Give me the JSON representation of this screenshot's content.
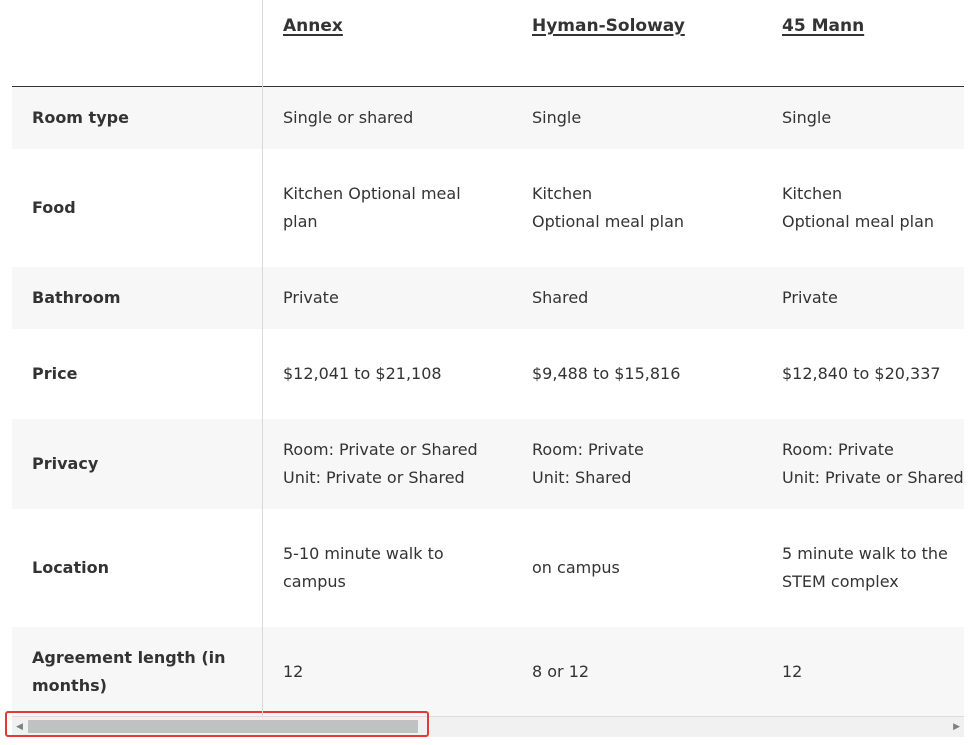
{
  "columns": [
    "Annex",
    "Hyman-Soloway",
    "45 Mann"
  ],
  "rows": [
    {
      "label": "Room type",
      "cells": [
        [
          "Single or shared"
        ],
        [
          "Single"
        ],
        [
          "Single"
        ]
      ]
    },
    {
      "label": "Food",
      "cells": [
        [
          "Kitchen Optional meal",
          "plan"
        ],
        [
          "Kitchen",
          "Optional meal plan"
        ],
        [
          "Kitchen",
          "Optional meal plan"
        ]
      ]
    },
    {
      "label": "Bathroom",
      "cells": [
        [
          "Private"
        ],
        [
          "Shared"
        ],
        [
          "Private"
        ]
      ]
    },
    {
      "label": "Price",
      "cells": [
        [
          "$12,041 to $21,108"
        ],
        [
          "$9,488 to $15,816"
        ],
        [
          "$12,840 to $20,337"
        ]
      ]
    },
    {
      "label": "Privacy",
      "cells": [
        [
          "Room: Private or Shared",
          "Unit: Private or Shared"
        ],
        [
          "Room: Private",
          "Unit: Shared"
        ],
        [
          "Room: Private",
          "Unit: Private or Shared"
        ]
      ]
    },
    {
      "label": "Location",
      "cells": [
        [
          "5-10 minute walk to",
          "campus"
        ],
        [
          "on campus"
        ],
        [
          "5 minute walk to the",
          "STEM complex"
        ]
      ]
    },
    {
      "label": [
        "Agreement length (in",
        "months)"
      ],
      "cells": [
        [
          "12"
        ],
        [
          "8 or 12"
        ],
        [
          "12"
        ]
      ]
    }
  ],
  "scrollbar": {
    "left_arrow": "◀",
    "right_arrow": "▶",
    "highlight_color": "#e53935"
  }
}
